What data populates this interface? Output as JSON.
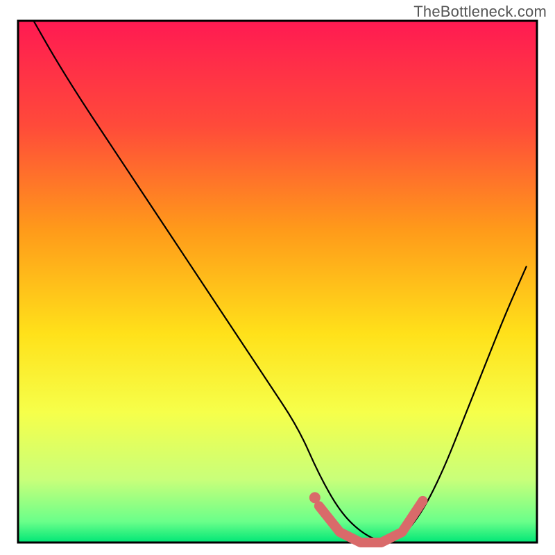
{
  "watermark": "TheBottleneck.com",
  "chart_data": {
    "type": "line",
    "title": "",
    "xlabel": "",
    "ylabel": "",
    "xlim": [
      0,
      100
    ],
    "ylim": [
      0,
      100
    ],
    "series": [
      {
        "name": "bottleneck-curve",
        "x": [
          3,
          7,
          12,
          18,
          24,
          30,
          36,
          42,
          48,
          54,
          58,
          62,
          66,
          70,
          74,
          78,
          82,
          86,
          90,
          94,
          98
        ],
        "y": [
          100,
          93,
          85,
          76,
          67,
          58,
          49,
          40,
          31,
          22,
          13,
          6,
          2,
          0,
          1,
          6,
          14,
          24,
          34,
          44,
          53
        ]
      }
    ],
    "highlight": {
      "name": "optimal-range",
      "x": [
        58,
        62,
        66,
        70,
        74,
        78
      ],
      "y": [
        7,
        2,
        0,
        0,
        2,
        8
      ]
    },
    "gradient_stops": [
      {
        "offset": 0,
        "color": "#ff1a52"
      },
      {
        "offset": 20,
        "color": "#ff4a3a"
      },
      {
        "offset": 40,
        "color": "#ff9a1a"
      },
      {
        "offset": 60,
        "color": "#ffe11a"
      },
      {
        "offset": 75,
        "color": "#f6ff4a"
      },
      {
        "offset": 88,
        "color": "#c8ff7a"
      },
      {
        "offset": 96,
        "color": "#6aff8a"
      },
      {
        "offset": 100,
        "color": "#00e676"
      }
    ],
    "border_color": "#000000",
    "curve_color": "#000000",
    "highlight_color": "#d96a6a"
  }
}
